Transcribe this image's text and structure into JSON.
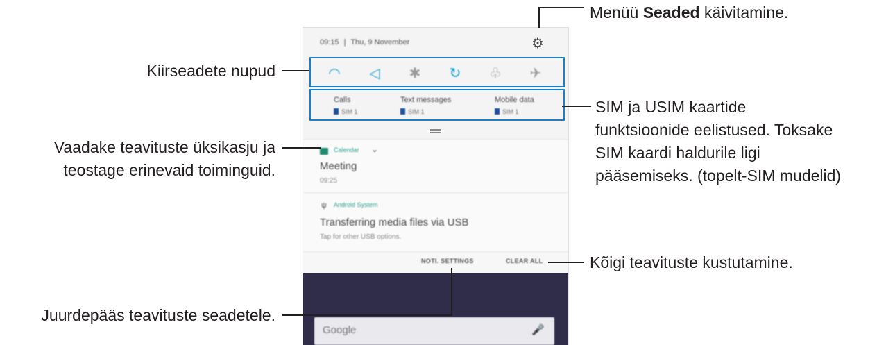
{
  "phone": {
    "status": {
      "time": "09:15",
      "separator": "|",
      "date": "Thu, 9 November"
    },
    "quick_settings": [
      {
        "name": "wifi",
        "glyph": "◠",
        "active": true
      },
      {
        "name": "sound",
        "glyph": "◁",
        "active": true
      },
      {
        "name": "bluetooth",
        "glyph": "✱",
        "active": false
      },
      {
        "name": "auto-rotate",
        "glyph": "↻",
        "active": true
      },
      {
        "name": "flashlight",
        "glyph": "♧",
        "active": false
      },
      {
        "name": "airplane",
        "glyph": "✈",
        "active": false
      }
    ],
    "sim": [
      {
        "label": "Calls",
        "sim": "SIM 1"
      },
      {
        "label": "Text messages",
        "sim": "SIM 1"
      },
      {
        "label": "Mobile data",
        "sim": "SIM 1"
      }
    ],
    "notifications": [
      {
        "app": "Calendar",
        "title": "Meeting",
        "text": "09:25"
      },
      {
        "app": "Android System",
        "title": "Transferring media files via USB",
        "text": "Tap for other USB options."
      }
    ],
    "actions": {
      "noti_settings": "NOTI. SETTINGS",
      "clear_all": "CLEAR ALL"
    },
    "search": {
      "label": "Google"
    }
  },
  "callouts": {
    "settings_pre": "Menüü ",
    "settings_bold": "Seaded",
    "settings_post": " käivitamine.",
    "quick": "Kiirseadete nupud",
    "sim_line1": "SIM ja USIM kaartide",
    "sim_line2": "funktsioonide eelistused. Toksake",
    "sim_line3": "SIM kaardi haldurile ligi",
    "sim_line4": "pääsemiseks. (topelt-SIM mudelid)",
    "details_line1": "Vaadake teavituste üksikasju ja",
    "details_line2": "teostage erinevaid toiminguid.",
    "clear": "Kõigi teavituste kustutamine.",
    "noti_settings": "Juurdepääs teavituste seadetele."
  },
  "colors": {
    "highlight_box": "#1b7fc1",
    "accent": "#1a9ec8",
    "home_bg": "#2f2d4a"
  }
}
